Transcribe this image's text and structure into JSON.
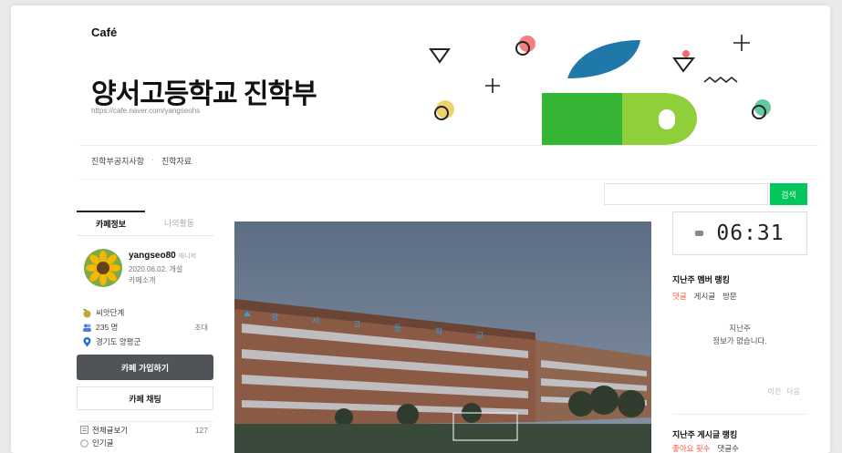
{
  "header": {
    "brand": "Café",
    "cafe_name": "양서고등학교 진학부",
    "cafe_url": "https://cafe.naver.com/yangseohs"
  },
  "menu": {
    "items": [
      "진학부공지사항",
      "진학자료"
    ],
    "separator": "·"
  },
  "search": {
    "placeholder": "",
    "button_label": "검색",
    "accent_color": "#03c75a"
  },
  "sidebar": {
    "tabs": [
      "카페정보",
      "나의활동"
    ],
    "profile": {
      "name": "yangseo80",
      "role": "매니저",
      "date": "2020.06.02. 개설",
      "intro": "카페소개"
    },
    "stats": [
      {
        "icon": "seedling-icon",
        "label": "씨앗단계",
        "right": ""
      },
      {
        "icon": "members-icon",
        "label": "235 명",
        "right": "초대"
      },
      {
        "icon": "location-pin-icon",
        "label": "경기도 양평군",
        "right": ""
      }
    ],
    "join_label": "카페 가입하기",
    "chat_label": "카페 채팅",
    "boards": [
      {
        "icon": "all-posts-icon",
        "label": "전체글보기",
        "count": "127"
      },
      {
        "icon": "popular-icon",
        "label": "인기글",
        "count": ""
      }
    ]
  },
  "clock": {
    "time": "06:31"
  },
  "member_ranking": {
    "title": "지난주 멤버 랭킹",
    "tabs": [
      "댓글",
      "게시글",
      "방문"
    ],
    "active_tab": "댓글",
    "empty_line1": "지난주",
    "empty_line2": "정보가 없습니다.",
    "prev_label": "이전",
    "next_label": "다음"
  },
  "post_ranking": {
    "title": "지난주 게시글 랭킹",
    "tabs": [
      "좋아요 횟수",
      "댓글수"
    ],
    "active_tab": "좋아요 횟수"
  },
  "photo": {
    "building_sign": "양서고등학교"
  }
}
